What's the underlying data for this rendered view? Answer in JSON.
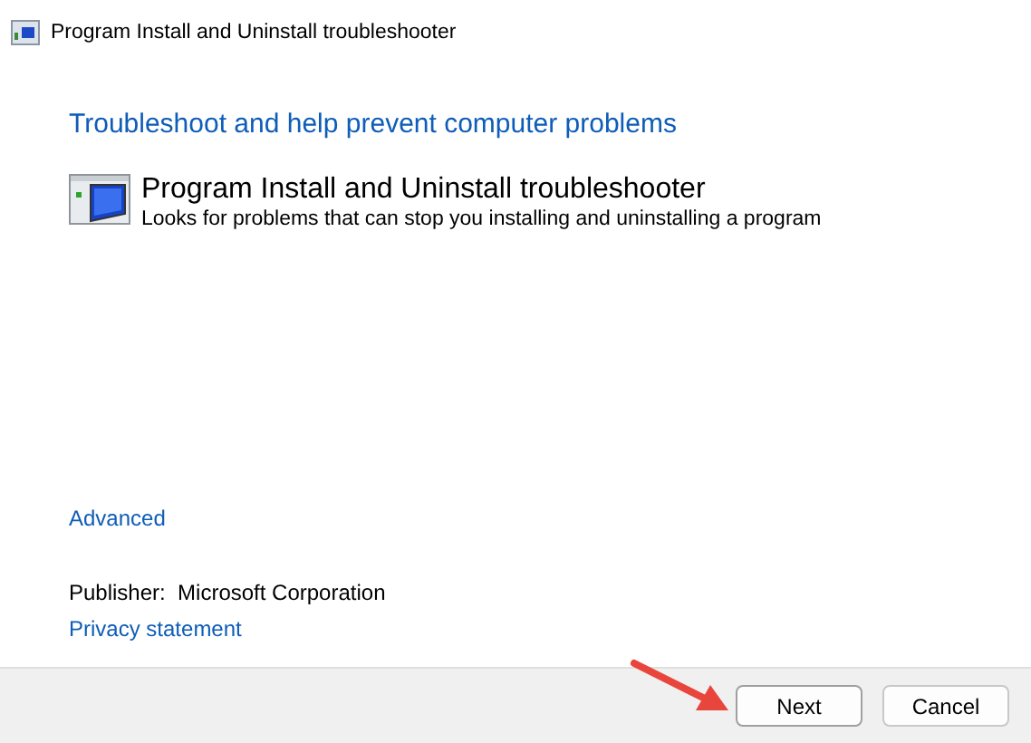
{
  "window": {
    "title": "Program Install and Uninstall troubleshooter"
  },
  "heading": "Troubleshoot and help prevent computer problems",
  "troubleshooter": {
    "name": "Program Install and Uninstall troubleshooter",
    "description": "Looks for problems that can stop you installing and uninstalling a program"
  },
  "advanced_link": "Advanced",
  "publisher": {
    "label": "Publisher:",
    "value": "Microsoft Corporation"
  },
  "privacy_link": "Privacy statement",
  "buttons": [
    {
      "label": "Next",
      "highlighted": true
    },
    {
      "label": "Cancel",
      "highlighted": false
    }
  ]
}
